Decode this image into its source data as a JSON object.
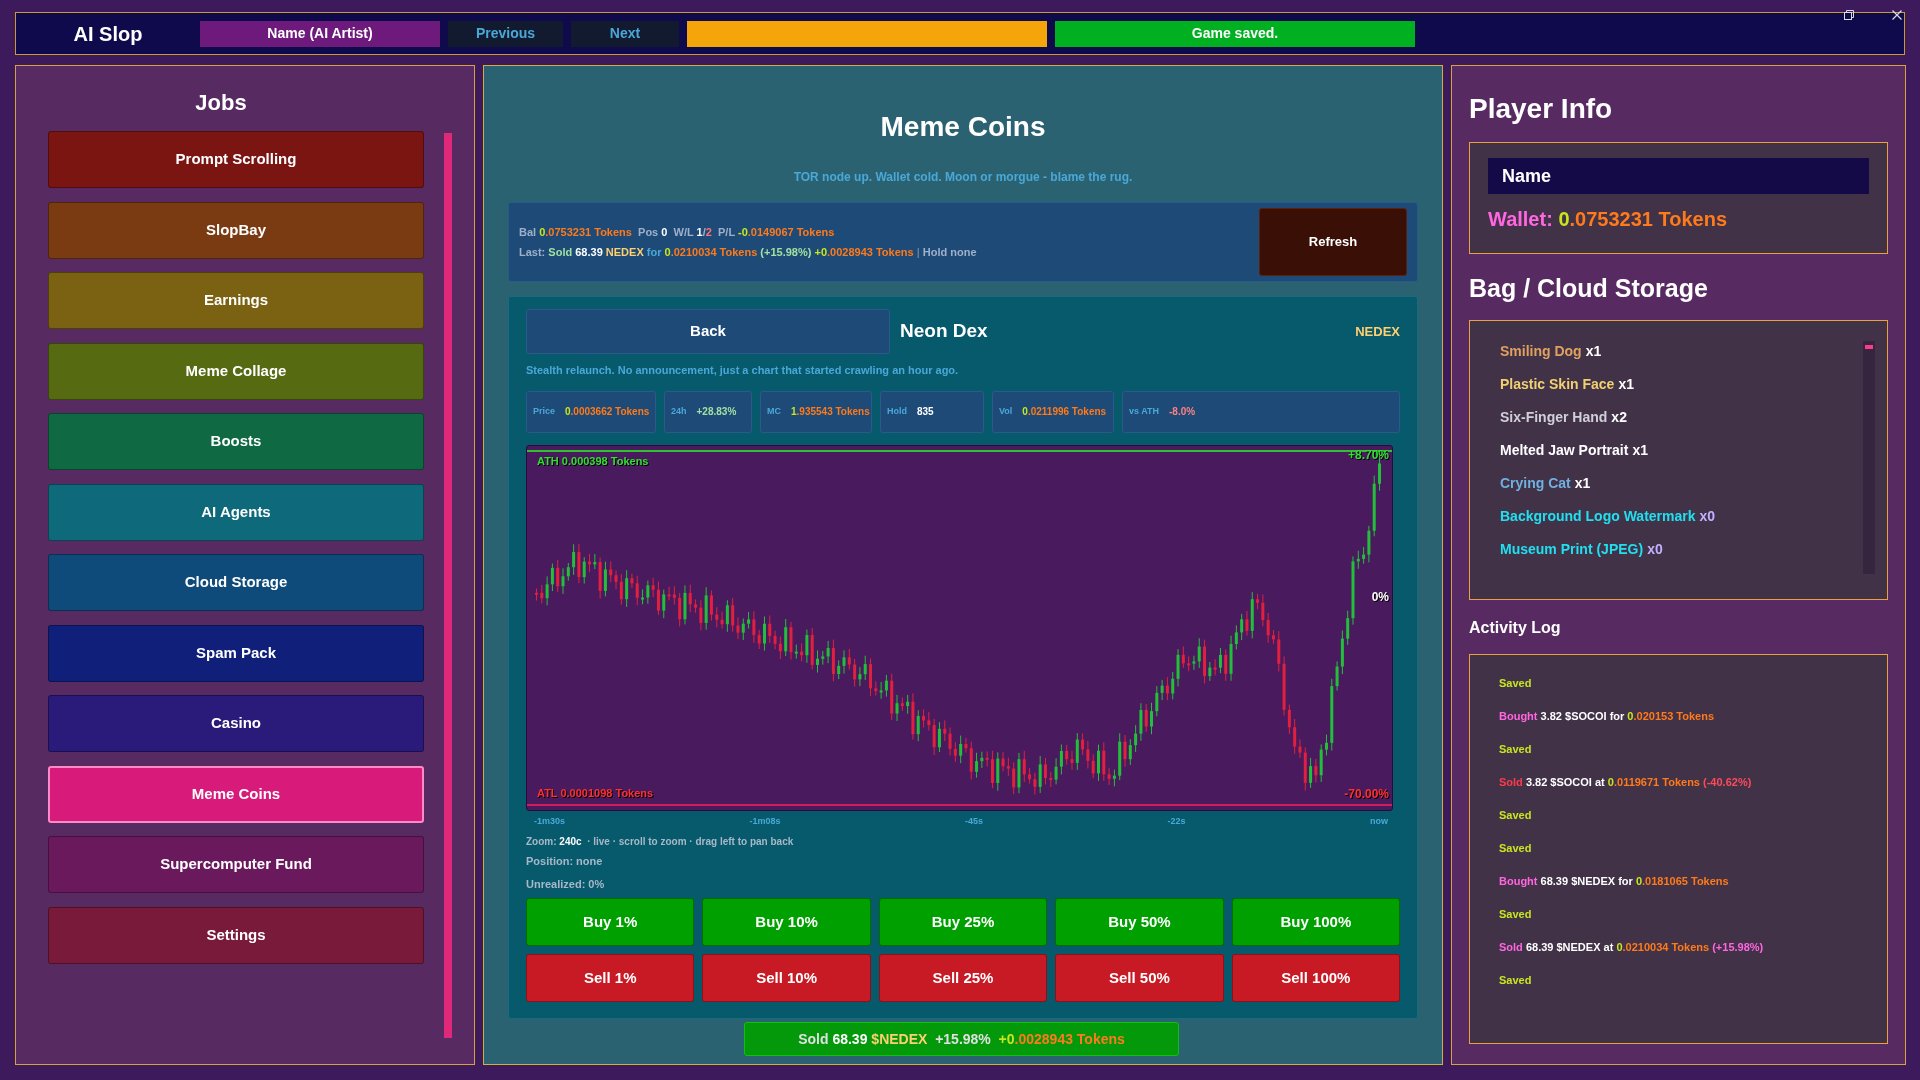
{
  "top_bar": {
    "title": "AI Slop",
    "name_button": "Name (AI Artist)",
    "previous": "Previous",
    "next": "Next",
    "save_status": "Game saved."
  },
  "jobs": {
    "title": "Jobs",
    "items": [
      {
        "label": "Prompt Scrolling",
        "color": "#7a1512",
        "selected": false
      },
      {
        "label": "SlopBay",
        "color": "#7a3a12",
        "selected": false
      },
      {
        "label": "Earnings",
        "color": "#7a6212",
        "selected": false
      },
      {
        "label": "Meme Collage",
        "color": "#566a12",
        "selected": false
      },
      {
        "label": "Boosts",
        "color": "#0f6a44",
        "selected": false
      },
      {
        "label": "AI Agents",
        "color": "#0e6a7a",
        "selected": false
      },
      {
        "label": "Cloud Storage",
        "color": "#0e4a7a",
        "selected": false
      },
      {
        "label": "Spam Pack",
        "color": "#10207a",
        "selected": false
      },
      {
        "label": "Casino",
        "color": "#2a1a7a",
        "selected": false
      },
      {
        "label": "Meme Coins",
        "color": "#d81b7a",
        "selected": true
      },
      {
        "label": "Supercomputer Fund",
        "color": "#6a1a5c",
        "selected": false
      },
      {
        "label": "Settings",
        "color": "#7a1a3a",
        "selected": false
      }
    ]
  },
  "meme_coins": {
    "title": "Meme Coins",
    "subtitle": "TOR node up. Wallet cold. Moon or morgue - blame the rug.",
    "summary": {
      "line_1": [
        {
          "text": "Bal ",
          "color": "#9fb0c8"
        },
        {
          "text": "0",
          "color": "#c8e61e"
        },
        {
          "text": ".0753231 Tokens ",
          "color": "#ff7a1a"
        },
        {
          "text": " Pos ",
          "color": "#9fb0c8"
        },
        {
          "text": "0 ",
          "color": "#ffffff"
        },
        {
          "text": " W/L ",
          "color": "#9fb0c8"
        },
        {
          "text": "1",
          "color": "#ffffff"
        },
        {
          "text": "/",
          "color": "#9fb0c8"
        },
        {
          "text": "2 ",
          "color": "#ff7070"
        },
        {
          "text": " P/L ",
          "color": "#9fb0c8"
        },
        {
          "text": "-0",
          "color": "#c8e61e"
        },
        {
          "text": ".0149067 Tokens",
          "color": "#ff7a1a"
        }
      ],
      "line_2": [
        {
          "text": "Last: ",
          "color": "#9fb0c8"
        },
        {
          "text": "Sold ",
          "color": "#a0e0a0"
        },
        {
          "text": "68.39 ",
          "color": "#ffffff"
        },
        {
          "text": "NEDEX ",
          "color": "#ffd070"
        },
        {
          "text": "for ",
          "color": "#4aa8d8"
        },
        {
          "text": "0",
          "color": "#c8e61e"
        },
        {
          "text": ".0210034 Tokens ",
          "color": "#ff7a1a"
        },
        {
          "text": "(+15.98%) ",
          "color": "#a0e0a0"
        },
        {
          "text": "+0",
          "color": "#c8e61e"
        },
        {
          "text": ".0028943 Tokens ",
          "color": "#ff7a1a"
        },
        {
          "text": "| ",
          "color": "#6a7a98"
        },
        {
          "text": "Hold none",
          "color": "#9fb0c8"
        }
      ],
      "refresh": "Refresh"
    },
    "coin": {
      "back": "Back",
      "name": "Neon Dex",
      "ticker": "NEDEX",
      "description": "Stealth relaunch. No announcement, just a chart that started crawling an hour ago.",
      "stats": [
        {
          "label": "Price",
          "value": [
            {
              "text": "0",
              "color": "#c8e61e"
            },
            {
              "text": ".0003662 Tokens",
              "color": "#ff7a1a"
            }
          ]
        },
        {
          "label": "24h",
          "value": [
            {
              "text": "+28.83%",
              "color": "#a0e0a0"
            }
          ]
        },
        {
          "label": "MC",
          "value": [
            {
              "text": "1",
              "color": "#c8e61e"
            },
            {
              "text": ".935543 Tokens",
              "color": "#ff7a1a"
            }
          ]
        },
        {
          "label": "Hold",
          "value": [
            {
              "text": "835",
              "color": "#ffffff"
            }
          ]
        },
        {
          "label": "Vol",
          "value": [
            {
              "text": "0",
              "color": "#c8e61e"
            },
            {
              "text": ".0211996 Tokens",
              "color": "#ff7a1a"
            }
          ]
        },
        {
          "label": "vs ATH",
          "value": [
            {
              "text": "-8.0%",
              "color": "#ff8080"
            }
          ]
        }
      ],
      "chart": {
        "ath": "ATH 0.000398 Tokens",
        "atl": "ATL 0.0001098 Tokens",
        "top_pct": "+8.70%",
        "mid_pct": "0%",
        "bottom_pct": "-70.00%",
        "x_labels": [
          "-1m30s",
          "-1m08s",
          "-45s",
          "-22s",
          "now"
        ]
      },
      "zoom": [
        {
          "text": "Zoom: ",
          "color": "#a8b8c8"
        },
        {
          "text": "240c",
          "color": "#ffffff"
        },
        {
          "text": "  · live · scroll to zoom · drag left to pan back",
          "color": "#a8b8c8"
        }
      ],
      "position": "Position: none",
      "unrealized": "Unrealized: 0%",
      "buy_buttons": [
        "Buy 1%",
        "Buy 10%",
        "Buy 25%",
        "Buy 50%",
        "Buy 100%"
      ],
      "sell_buttons": [
        "Sell 1%",
        "Sell 10%",
        "Sell 25%",
        "Sell 50%",
        "Sell 100%"
      ]
    },
    "toast": [
      {
        "text": "Sold ",
        "color": "#e0e0e0"
      },
      {
        "text": "68.39 ",
        "color": "#ffffff"
      },
      {
        "text": "$NEDEX ",
        "color": "#ffd070"
      },
      {
        "text": " +15.98% ",
        "color": "#e0e0e0"
      },
      {
        "text": " +0",
        "color": "#c8e61e"
      },
      {
        "text": ".0028943 Tokens",
        "color": "#ff7a1a"
      }
    ]
  },
  "player_info": {
    "title": "Player Info",
    "name": "Name",
    "wallet": [
      {
        "text": "Wallet: ",
        "color": "#ff66e0"
      },
      {
        "text": "0",
        "color": "#c8e61e"
      },
      {
        "text": ".0753231 Tokens",
        "color": "#ff7a1a"
      }
    ]
  },
  "bag": {
    "title": "Bag / Cloud Storage",
    "items": [
      [
        {
          "text": "Smiling Dog",
          "color": "#e0a060"
        },
        {
          "text": "x1",
          "color": "#ffffff"
        }
      ],
      [
        {
          "text": "Plastic Skin Face",
          "color": "#f0d070"
        },
        {
          "text": "x1",
          "color": "#ffffff"
        }
      ],
      [
        {
          "text": "Six-Finger Hand",
          "color": "#d0d0d8"
        },
        {
          "text": "x2",
          "color": "#ffffff"
        }
      ],
      [
        {
          "text": "Melted Jaw Portrait",
          "color": "#ffffff"
        },
        {
          "text": "x1",
          "color": "#ffffff"
        }
      ],
      [
        {
          "text": "Crying Cat",
          "color": "#70b0e0"
        },
        {
          "text": "x1",
          "color": "#ffffff"
        }
      ],
      [
        {
          "text": "Background Logo Watermark",
          "color": "#20e0f0"
        },
        {
          "text": "x0",
          "color": "#c0b0ff"
        }
      ],
      [
        {
          "text": "Museum Print (JPEG)",
          "color": "#20e0f0"
        },
        {
          "text": "x0",
          "color": "#c0b0ff"
        }
      ]
    ]
  },
  "activity_log": {
    "title": "Activity Log",
    "entries": [
      [
        {
          "text": "Saved",
          "color": "#c8e61e"
        }
      ],
      [
        {
          "text": "Bought ",
          "color": "#ff66e0"
        },
        {
          "text": "3.82 $SOCOI for ",
          "color": "#ffffff"
        },
        {
          "text": "0",
          "color": "#c8e61e"
        },
        {
          "text": ".020153 Tokens",
          "color": "#ff7a1a"
        }
      ],
      [
        {
          "text": "Saved",
          "color": "#c8e61e"
        }
      ],
      [
        {
          "text": "Sold ",
          "color": "#ff3a4a"
        },
        {
          "text": "3.82 $SOCOI at ",
          "color": "#ffffff"
        },
        {
          "text": "0",
          "color": "#c8e61e"
        },
        {
          "text": ".0119671 Tokens ",
          "color": "#ff7a1a"
        },
        {
          "text": "(-40.62%)",
          "color": "#ff4a5a"
        }
      ],
      [
        {
          "text": "Saved",
          "color": "#c8e61e"
        }
      ],
      [
        {
          "text": "Saved",
          "color": "#c8e61e"
        }
      ],
      [
        {
          "text": "Bought ",
          "color": "#ff66e0"
        },
        {
          "text": "68.39 $NEDEX for ",
          "color": "#ffffff"
        },
        {
          "text": "0",
          "color": "#c8e61e"
        },
        {
          "text": ".0181065 Tokens",
          "color": "#ff7a1a"
        }
      ],
      [
        {
          "text": "Saved",
          "color": "#c8e61e"
        }
      ],
      [
        {
          "text": "Sold ",
          "color": "#ff66e0"
        },
        {
          "text": "68.39 $NEDEX at ",
          "color": "#ffffff"
        },
        {
          "text": "0",
          "color": "#c8e61e"
        },
        {
          "text": ".0210034 Tokens ",
          "color": "#ff7a1a"
        },
        {
          "text": "(+15.98%)",
          "color": "#ff66e0"
        }
      ],
      [
        {
          "text": "Saved",
          "color": "#c8e61e"
        }
      ]
    ]
  }
}
